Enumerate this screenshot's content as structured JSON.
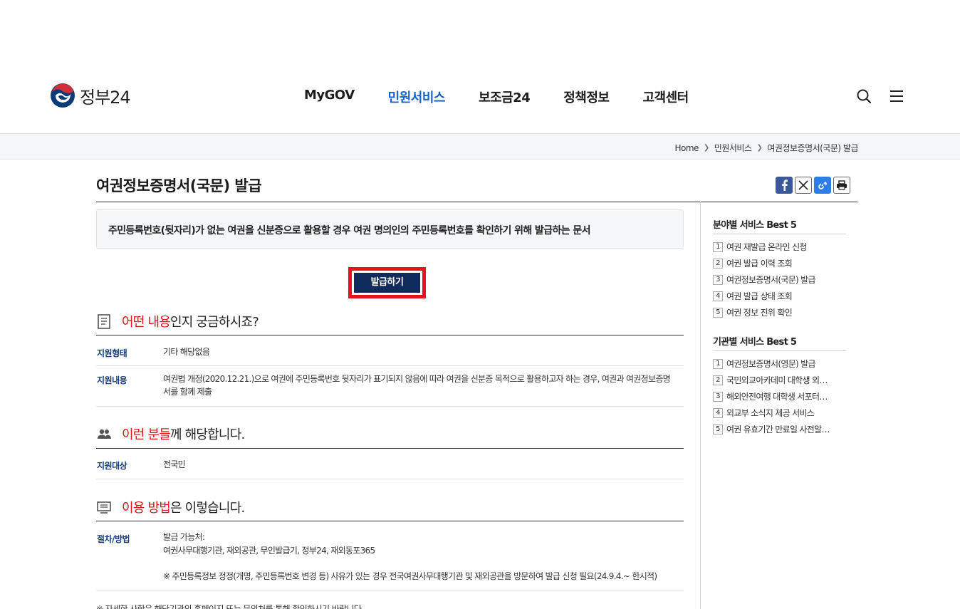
{
  "header": {
    "logo_text": "정부24",
    "nav": [
      {
        "label": "MyGOV",
        "active": false
      },
      {
        "label": "민원서비스",
        "active": true
      },
      {
        "label": "보조금24",
        "active": false
      },
      {
        "label": "정책정보",
        "active": false
      },
      {
        "label": "고객센터",
        "active": false
      }
    ],
    "icons": [
      "search-icon",
      "menu-icon"
    ]
  },
  "breadcrumb": [
    "Home",
    "민원서비스",
    "여권정보증명서(국문) 발급"
  ],
  "page": {
    "title": "여권정보증명서(국문) 발급",
    "share_icons": [
      "facebook-icon",
      "x-icon",
      "link-icon",
      "print-icon"
    ],
    "summary": "주민등록번호(뒷자리)가 없는 여권을 신분증으로 활용할 경우 여권 명의인의 주민등록번호를 확인하기 위해 발급하는 문서",
    "issue_button": "발급하기"
  },
  "sections": {
    "content": {
      "highlight": "어떤 내용",
      "rest": "인지 궁금하시죠?",
      "rows": [
        {
          "label": "지원형태",
          "value": "기타 해당없음"
        },
        {
          "label": "지원내용",
          "value": "여권법 개정(2020.12.21.)으로 여권에 주민등록번호 뒷자리가 표기되지 않음에 따라 여권을 신분증 목적으로 활용하고자 하는 경우, 여권과 여권정보증명서를 함께 제출"
        }
      ]
    },
    "target": {
      "highlight": "이런 분들",
      "rest": "께 해당합니다.",
      "rows": [
        {
          "label": "지원대상",
          "value": "전국민"
        }
      ]
    },
    "method": {
      "highlight": "이용 방법",
      "rest": "은 이렇습니다.",
      "rows": [
        {
          "label": "절차/방법",
          "line1": "발급 가능처:",
          "line2": "여권사무대행기관, 재외공관, 무인발급기, 정부24, 재외동포365",
          "line3": "※ 주민등록정보 정정(개명, 주민등록번호 변경 등) 사유가 있는 경우 전국여권사무대행기관 및 재외공관을 방문하여 발급 신청 필요(24.9.4.~ 한시적)"
        }
      ]
    },
    "foot_note": "※ 자세한 사항은 해당기관의 홈페이지 또는 문의처를 통해 확인하시기 바랍니다."
  },
  "sidebar": {
    "field_best": {
      "title": "분야별 서비스 Best 5",
      "items": [
        "여권 재발급 온라인 신청",
        "여권 발급 이력 조회",
        "여권정보증명서(국문) 발급",
        "여권 발급 상태 조회",
        "여권 정보 진위 확인"
      ]
    },
    "agency_best": {
      "title": "기관별 서비스 Best 5",
      "items": [
        "여권정보증명서(영문) 발급",
        "국민외교아카데미 대학생 외교아카데미",
        "해외안전여행 대학생 서포터스 모집",
        "외교부 소식지 제공 서비스",
        "여권 유효기간 만료일 사전알림 서비스"
      ]
    }
  }
}
